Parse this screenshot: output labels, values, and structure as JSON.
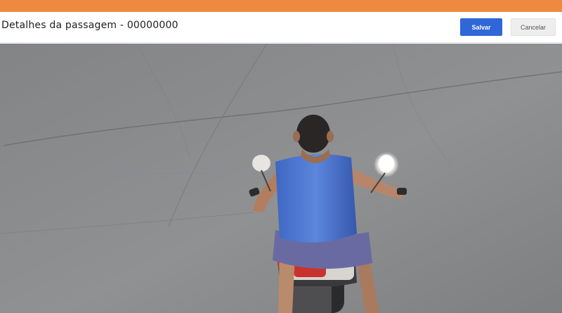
{
  "header": {
    "title": "Detalhes da passagem - 00000000",
    "primary_button_label": "Salvar",
    "secondary_button_label": "Cancelar"
  },
  "colors": {
    "topbar": "#ee8a3f",
    "primary_button": "#2f67d8",
    "secondary_button": "#eeeeee"
  },
  "main": {
    "image_subject": "motorcycle-rider-photo"
  }
}
